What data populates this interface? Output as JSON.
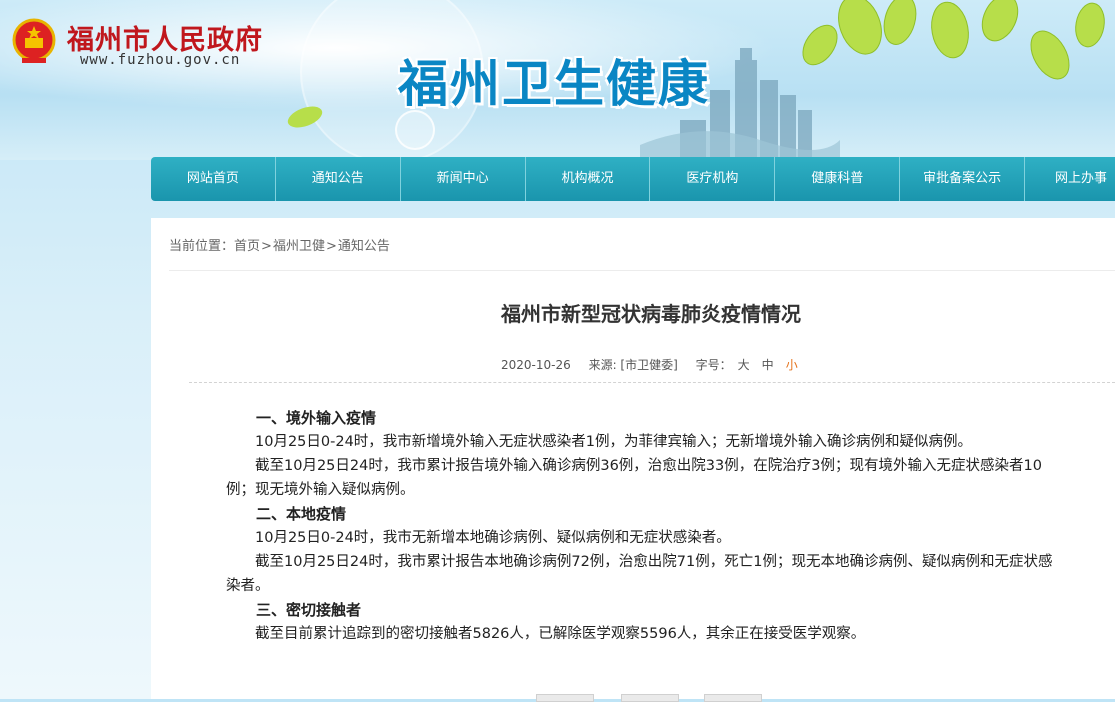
{
  "header": {
    "gov_name": "福州市人民政府",
    "gov_url": "www.fuzhou.gov.cn",
    "site_title": "福州卫生健康"
  },
  "nav": {
    "items": [
      {
        "label": "网站首页"
      },
      {
        "label": "通知公告"
      },
      {
        "label": "新闻中心"
      },
      {
        "label": "机构概况"
      },
      {
        "label": "医疗机构"
      },
      {
        "label": "健康科普"
      },
      {
        "label": "审批备案公示"
      },
      {
        "label": "网上办事"
      }
    ]
  },
  "breadcrumb": {
    "prefix": "当前位置：",
    "items": [
      "首页",
      "福州卫健",
      "通知公告"
    ],
    "sep": ">"
  },
  "article": {
    "title": "福州市新型冠状病毒肺炎疫情情况",
    "date": "2020-10-26",
    "source": "来源: [市卫健委]",
    "font_size_label": "字号：",
    "font_sizes": [
      "大",
      "中",
      "小"
    ],
    "sections": [
      {
        "heading": "一、境外输入疫情",
        "paragraphs": [
          "10月25日0-24时，我市新增境外输入无症状感染者1例，为菲律宾输入；无新增境外输入确诊病例和疑似病例。",
          "截至10月25日24时，我市累计报告境外输入确诊病例36例，治愈出院33例，在院治疗3例；现有境外输入无症状感染者10例；现无境外输入疑似病例。"
        ]
      },
      {
        "heading": "二、本地疫情",
        "paragraphs": [
          "10月25日0-24时，我市无新增本地确诊病例、疑似病例和无症状感染者。",
          "截至10月25日24时，我市累计报告本地确诊病例72例，治愈出院71例，死亡1例；现无本地确诊病例、疑似病例和无症状感染者。"
        ]
      },
      {
        "heading": "三、密切接触者",
        "paragraphs": [
          "截至目前累计追踪到的密切接触者5826人，已解除医学观察5596人，其余正在接受医学观察。"
        ]
      }
    ]
  },
  "colors": {
    "nav_bg": "#1a95ad",
    "gov_red": "#c0171d",
    "title_blue": "#0a86c4",
    "font_small_active": "#e5731c"
  }
}
